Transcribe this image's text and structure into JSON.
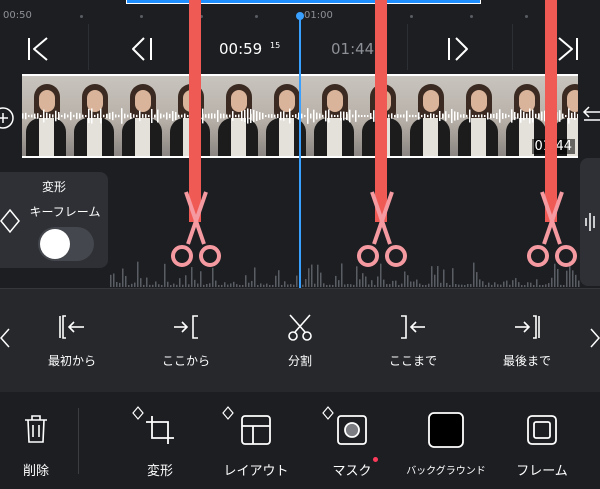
{
  "ruler": {
    "ticks": [
      {
        "label": "00:50"
      },
      {
        "label": "01:00"
      }
    ]
  },
  "controls": {
    "current_time": "00:59",
    "current_frames": "15",
    "duration": "01:44"
  },
  "filmstrip": {
    "clip_duration": "01:44"
  },
  "keyframe_panel": {
    "title": "変形",
    "label": "キーフレーム",
    "toggle_on": false
  },
  "split_tools": [
    {
      "label": "最初から",
      "icon": "trim-start-icon"
    },
    {
      "label": "ここから",
      "icon": "split-from-here-icon"
    },
    {
      "label": "分割",
      "icon": "scissors-icon"
    },
    {
      "label": "ここまで",
      "icon": "split-to-here-icon"
    },
    {
      "label": "最後まで",
      "icon": "trim-end-icon"
    }
  ],
  "bottom_tools": [
    {
      "label": "削除",
      "icon": "trash-icon"
    },
    {
      "label": "変形",
      "icon": "crop-icon"
    },
    {
      "label": "レイアウト",
      "icon": "layout-icon"
    },
    {
      "label": "マスク",
      "icon": "mask-icon"
    },
    {
      "label": "バックグラウンド",
      "icon": "background-icon"
    },
    {
      "label": "フレーム",
      "icon": "frame-icon"
    }
  ],
  "colors": {
    "accent_blue": "#1f8fff",
    "playhead": "#3aa0ff",
    "overlay_red": "#f05a55",
    "scissor_pink": "#f59aa0",
    "mask_dot": "#ff3b5c"
  }
}
